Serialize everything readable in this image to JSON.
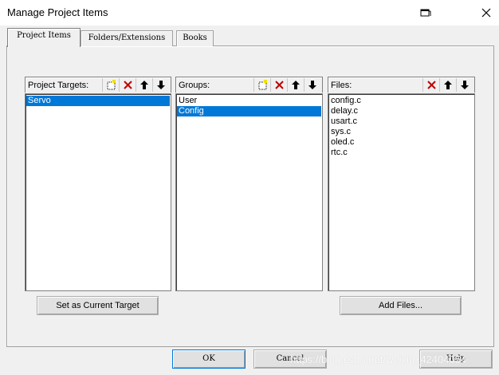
{
  "window": {
    "title": "Manage Project Items"
  },
  "titlebar": {
    "icons": [
      "restore-icon",
      "close-icon"
    ]
  },
  "tabs": [
    {
      "label": "Project Items",
      "active": true
    },
    {
      "label": "Folders/Extensions",
      "active": false
    },
    {
      "label": "Books",
      "active": false
    }
  ],
  "targets": {
    "label": "Project Targets:",
    "icons": [
      "new-icon",
      "delete-icon",
      "move-up-icon",
      "move-down-icon"
    ],
    "items": [
      "Servo"
    ],
    "selected": "Servo",
    "button_label": "Set as Current Target"
  },
  "groups": {
    "label": "Groups:",
    "icons": [
      "new-icon",
      "delete-icon",
      "move-up-icon",
      "move-down-icon"
    ],
    "items": [
      "User",
      "Config"
    ],
    "selected": "Config"
  },
  "files": {
    "label": "Files:",
    "icons": [
      "delete-icon",
      "move-up-icon",
      "move-down-icon"
    ],
    "items": [
      "config.c",
      "delay.c",
      "usart.c",
      "sys.c",
      "oled.c",
      "rtc.c"
    ],
    "button_label": "Add Files..."
  },
  "footer": {
    "ok": "OK",
    "cancel": "Cancel",
    "help": "Help"
  },
  "watermark": "https://blog.csdn.net/weixin_42404054",
  "colors": {
    "selection": "#0078d7",
    "delete": "#c00000"
  }
}
